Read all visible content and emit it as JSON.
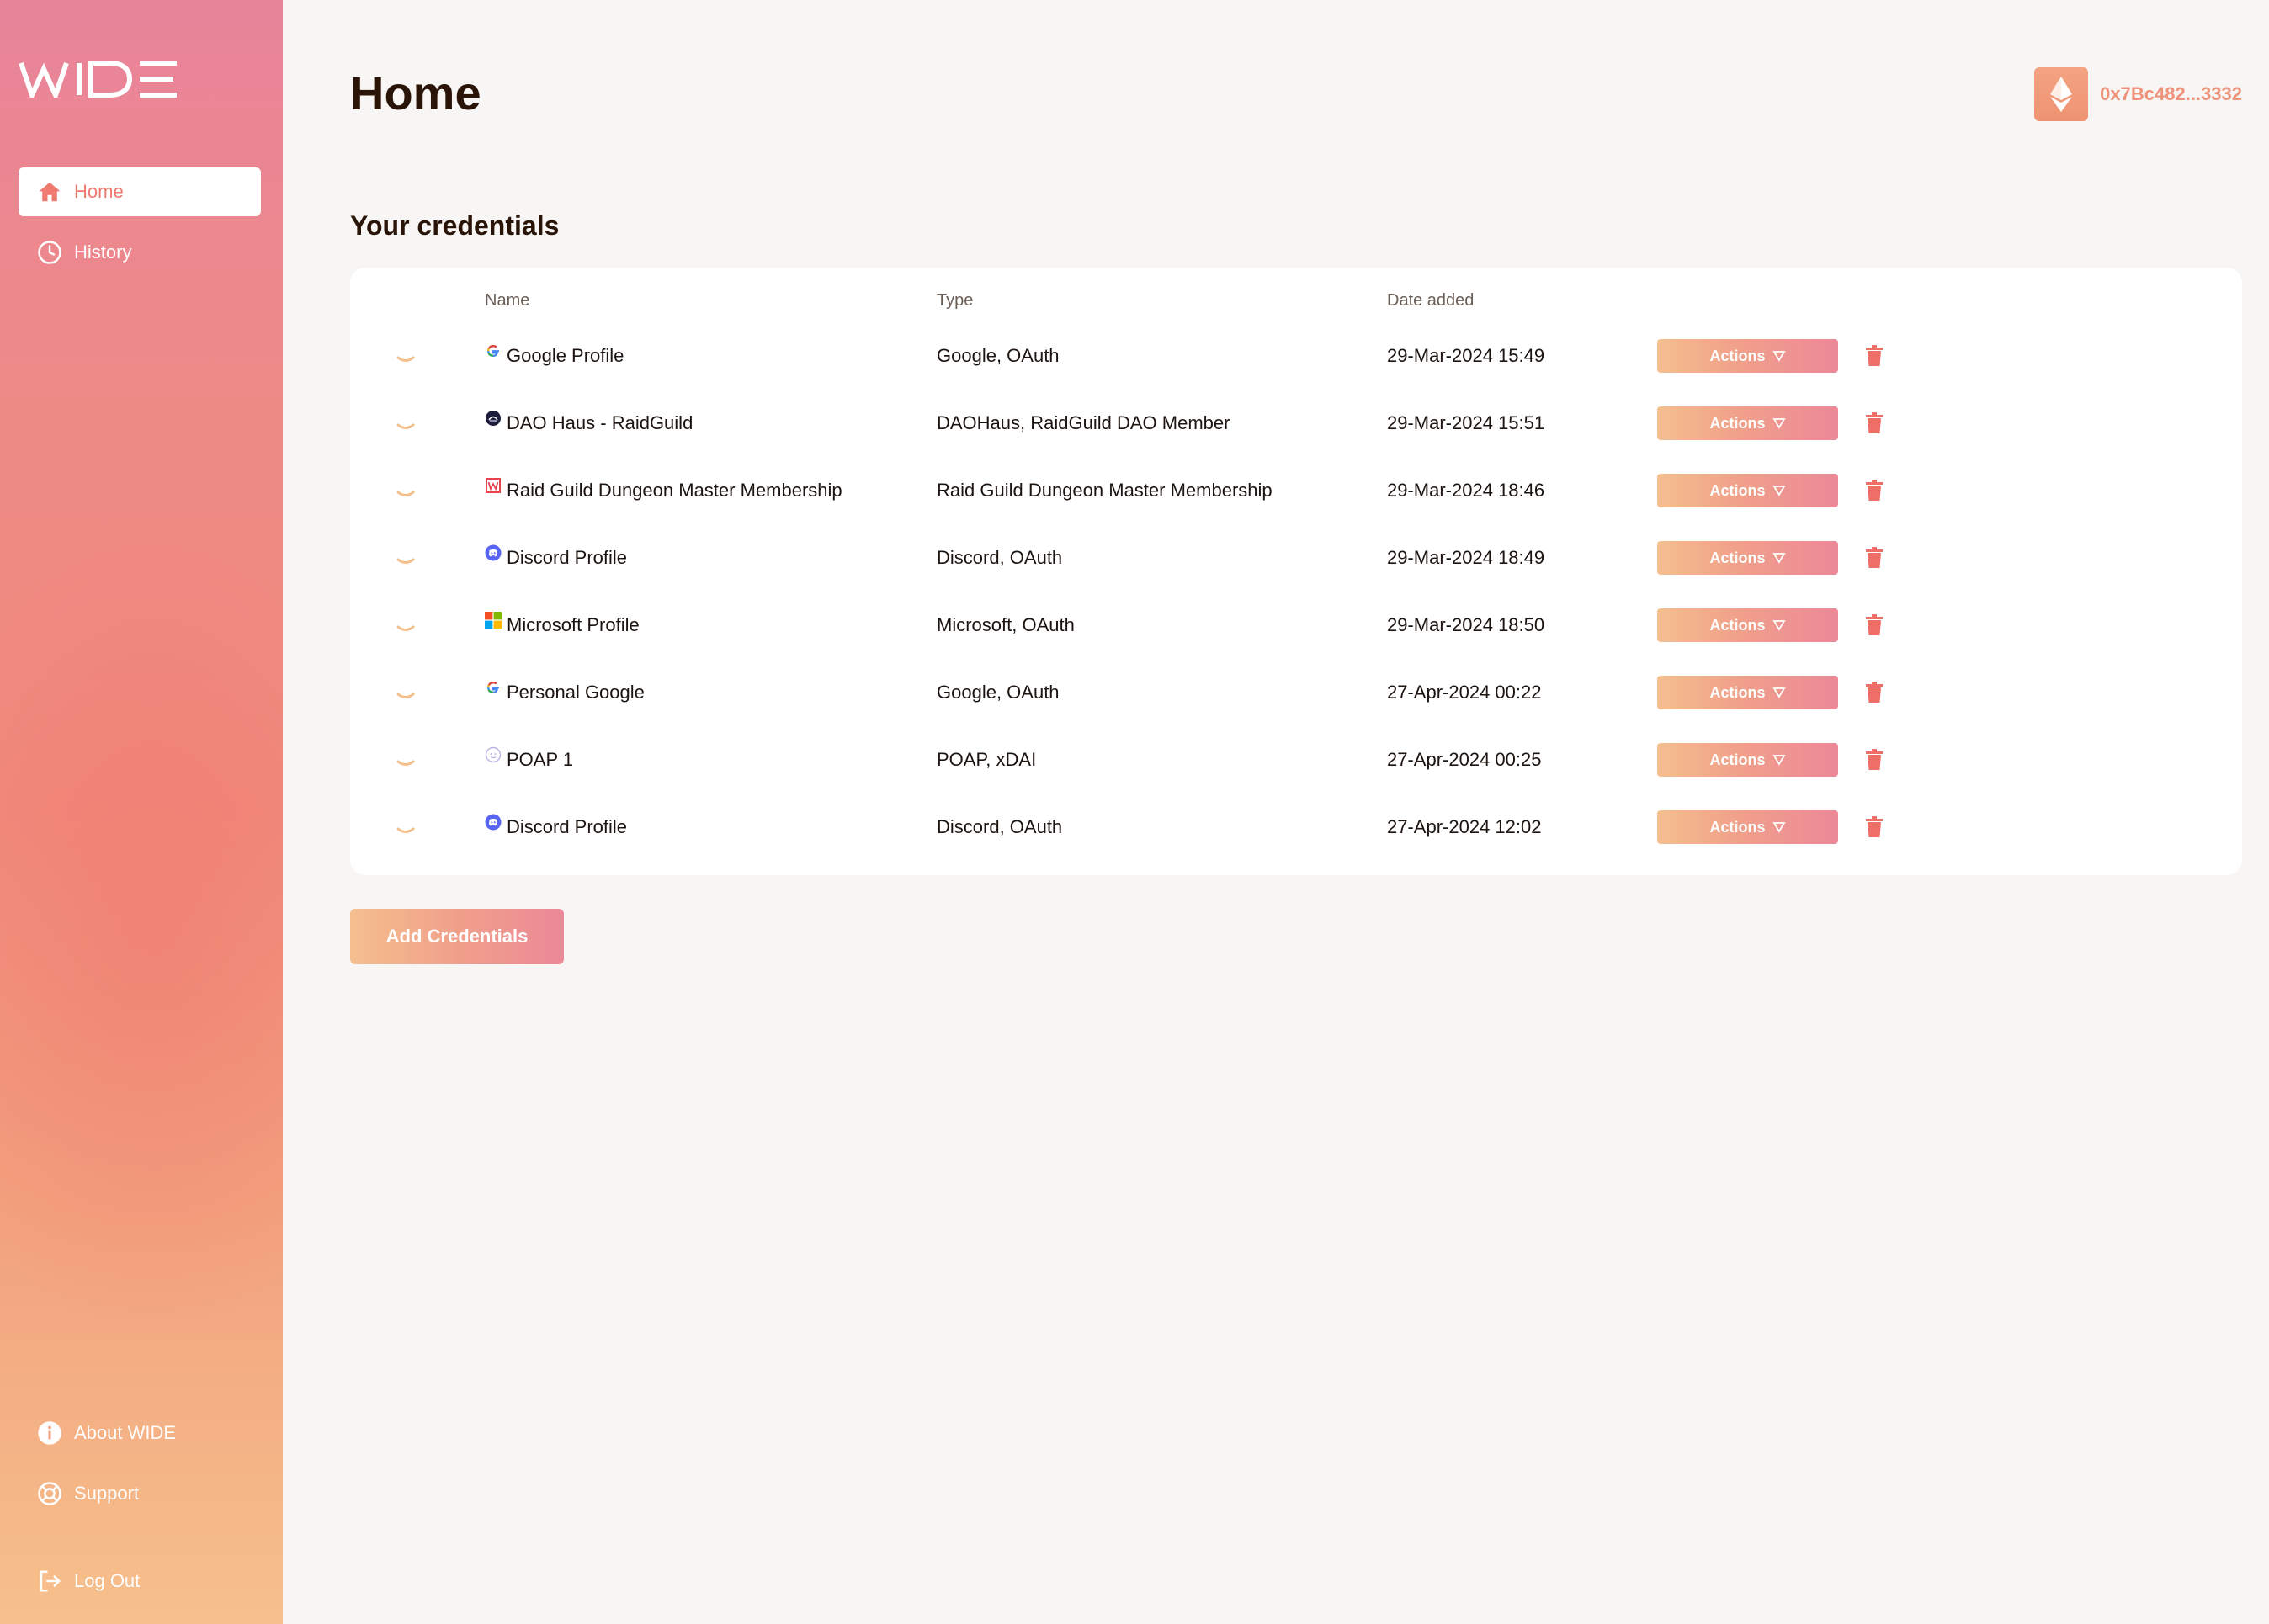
{
  "brand": {
    "logo_text": "WIDE",
    "accent": "#ee7a70"
  },
  "sidebar": {
    "top_items": [
      {
        "label": "Home",
        "icon": "home-icon",
        "active": true
      },
      {
        "label": "History",
        "icon": "clock-icon",
        "active": false
      }
    ],
    "bottom_items": [
      {
        "label": "About WIDE",
        "icon": "info-icon"
      },
      {
        "label": "Support",
        "icon": "lifebuoy-icon"
      },
      {
        "label": "Log Out",
        "icon": "logout-icon"
      }
    ]
  },
  "header": {
    "title": "Home",
    "account": {
      "icon": "ethereum-icon",
      "address": "0x7Bc482...3332"
    }
  },
  "credentials": {
    "section_title": "Your credentials",
    "columns": {
      "name": "Name",
      "type": "Type",
      "date": "Date added"
    },
    "actions_label": "Actions",
    "rows": [
      {
        "name": "Google Profile",
        "icon": "google-icon",
        "type": "Google, OAuth",
        "date": "29-Mar-2024 15:49"
      },
      {
        "name": "DAO Haus - RaidGuild",
        "icon": "daohaus-icon",
        "type": "DAOHaus, RaidGuild DAO Member",
        "date": "29-Mar-2024 15:51"
      },
      {
        "name": "Raid Guild Dungeon Master Membership",
        "icon": "raidguild-icon",
        "type": "Raid Guild Dungeon Master Membership",
        "date": "29-Mar-2024 18:46"
      },
      {
        "name": "Discord Profile",
        "icon": "discord-icon",
        "type": "Discord, OAuth",
        "date": "29-Mar-2024 18:49"
      },
      {
        "name": "Microsoft Profile",
        "icon": "microsoft-icon",
        "type": "Microsoft, OAuth",
        "date": "29-Mar-2024 18:50"
      },
      {
        "name": "Personal Google",
        "icon": "google-icon",
        "type": "Google, OAuth",
        "date": "27-Apr-2024 00:22"
      },
      {
        "name": "POAP 1",
        "icon": "poap-icon",
        "type": "POAP, xDAI",
        "date": "27-Apr-2024 00:25"
      },
      {
        "name": "Discord Profile",
        "icon": "discord-icon",
        "type": "Discord, OAuth",
        "date": "27-Apr-2024 12:02"
      }
    ]
  },
  "add_button_label": "Add Credentials"
}
